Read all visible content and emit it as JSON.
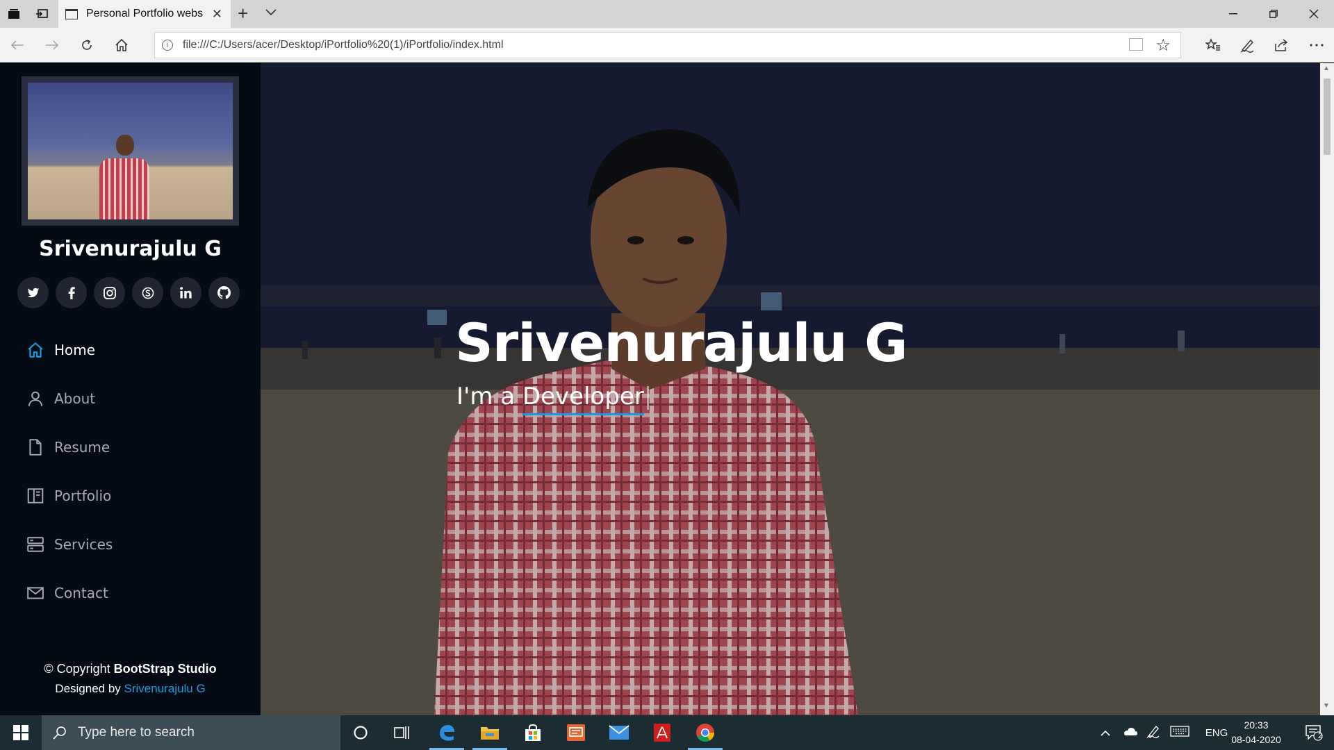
{
  "browser": {
    "tab_title": "Personal Portfolio webs",
    "url": "file:///C:/Users/acer/Desktop/iPortfolio%20(1)/iPortfolio/index.html",
    "new_tab": "+",
    "tab_close": "✕"
  },
  "sidebar": {
    "name": "Srivenurajulu G",
    "socials": [
      {
        "icon": "twitter-icon"
      },
      {
        "icon": "facebook-icon"
      },
      {
        "icon": "instagram-icon"
      },
      {
        "icon": "skype-icon"
      },
      {
        "icon": "linkedin-icon"
      },
      {
        "icon": "github-icon"
      }
    ],
    "nav": [
      {
        "label": "Home",
        "icon": "home-icon",
        "active": true
      },
      {
        "label": "About",
        "icon": "person-icon"
      },
      {
        "label": "Resume",
        "icon": "file-icon"
      },
      {
        "label": "Portfolio",
        "icon": "book-icon"
      },
      {
        "label": "Services",
        "icon": "server-icon"
      },
      {
        "label": "Contact",
        "icon": "envelope-icon"
      }
    ],
    "footer": {
      "copyright_prefix": "© Copyright ",
      "brand": "BootStrap Studio",
      "designed_by": "Designed by ",
      "author": "Srivenurajulu G"
    }
  },
  "hero": {
    "title": "Srivenurajulu G",
    "subtitle_prefix": "I'm a ",
    "typed_word": "Developer",
    "cursor": "|"
  },
  "taskbar": {
    "search_placeholder": "Type here to search",
    "language": "ENG",
    "time": "20:33",
    "date": "08-04-2020",
    "notification_count": "2"
  },
  "colors": {
    "accent": "#149ddd",
    "sidebar_bg": "#040b14",
    "social_bg": "#212431"
  }
}
